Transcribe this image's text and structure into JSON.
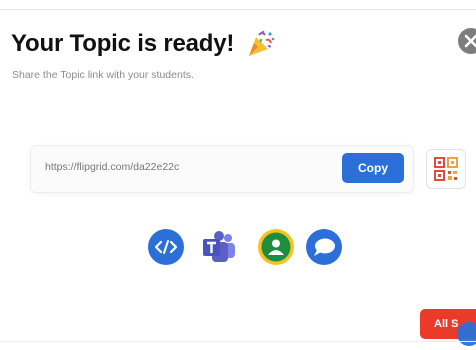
{
  "modal": {
    "title": "Your Topic is ready!",
    "subtitle": "Share the Topic link with your students.",
    "link_url": "https://flipgrid.com/da22e22c",
    "copy_label": "Copy",
    "all_sets_label": "All S"
  },
  "icons": {
    "title_icon": "party-popper-icon",
    "close_icon": "close-icon",
    "qr_icon": "qr-code-icon",
    "share_icons": [
      "embed-code-icon",
      "microsoft-teams-icon",
      "google-classroom-icon",
      "remind-chat-icon"
    ]
  },
  "colors": {
    "primary_blue": "#2c6fd9",
    "teams_purple": "#5b5fc7",
    "classroom_green": "#1e8e3e",
    "classroom_yellow": "#f9c31f",
    "accent_red": "#ea3b2a",
    "close_gray": "#7d7d7d"
  }
}
